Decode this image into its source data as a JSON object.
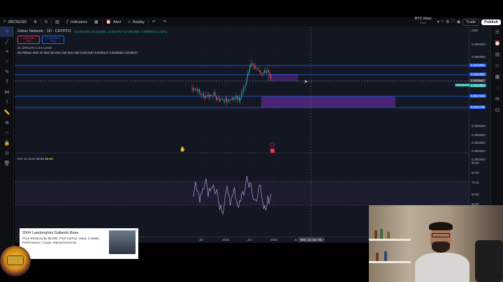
{
  "toolbar": {
    "symbol": "ZBCNUSD",
    "interval": "D",
    "indicators_label": "Indicators",
    "alert_label": "Alert",
    "replay_label": "Replay",
    "layout_name": "BTC Maxi",
    "layout_sub": "Save",
    "trade_label": "Trade",
    "publish_label": "Publish"
  },
  "legend": {
    "title": "Zebec Network · 1D · CRYPTO",
    "ohlc": "O0.0023755 H0.0024081 L0.0022757 C0.0022986 -0.0000918 (-3.82%)",
    "sell_price": "0.0022984",
    "sell_label": "Sell",
    "buy_price": "0.0023004",
    "buy_label": "Buy",
    "spread": "2.0",
    "line2": "ZC (ZRCLR) 4 Line Levels",
    "line3": "MA Ribbon SMA 20 SMA 50 SMA 100 SMA 200 0.0027597 0.0030147 0.0033653 0.0045047"
  },
  "price_axis": {
    "currency": "USD",
    "labels": [
      "0.0090000",
      "0.0060000",
      "0.0045082",
      "0.0031985",
      "0.0028467",
      "0.0022986",
      "0.0017159",
      "0.0011738",
      "0.0006500",
      "0.0005000",
      "0.0004000",
      "0.0003000",
      "0.0002900"
    ],
    "ticker_tag": "ZBCNUSD"
  },
  "time_axis": {
    "labels": [
      "Jul",
      "2025",
      "Jul",
      "2026",
      "Ju"
    ],
    "cursor_label": "Mon 12 Oct '26",
    "tail": "7"
  },
  "rsi": {
    "label": "RSI 14 close",
    "value1": "35.60",
    "value2": "29.86",
    "axis": [
      "90.00",
      "80.00",
      "70.00",
      "60.00",
      "50.00"
    ]
  },
  "ad": {
    "title": "2004 Lamborghini Gallardo Base",
    "body": "Price Reduced by $5,000, Free CarFax, Used, 2 seater, Performance, Coupe, Manual transmis...",
    "footer": "op",
    "close": "×"
  },
  "colors": {
    "candle_up": "#26a69a",
    "candle_down": "#ef5350",
    "level_line": "#2962ff",
    "zone": "#5b2a8e",
    "rsi_line": "#b39ddb",
    "background": "#131722"
  }
}
